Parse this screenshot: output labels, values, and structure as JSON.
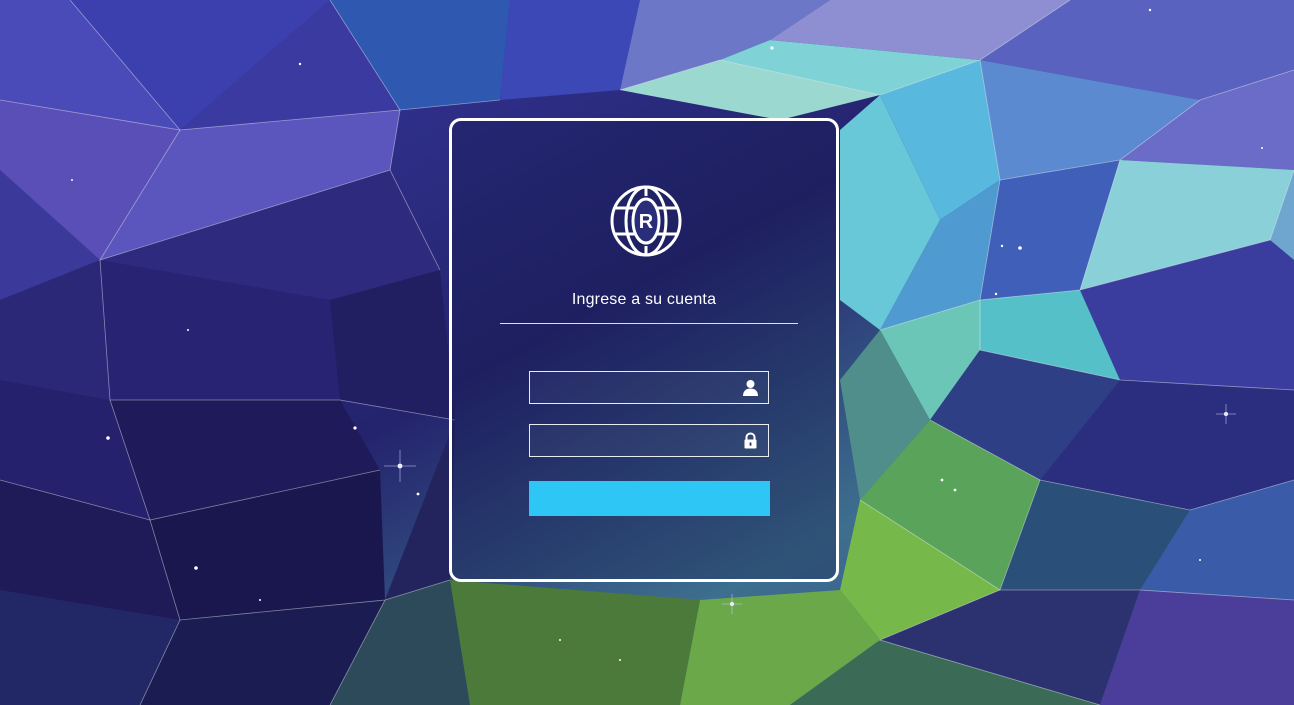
{
  "login": {
    "title": "Ingrese a su cuenta",
    "username": {
      "value": "",
      "placeholder": "",
      "icon": "user-icon"
    },
    "password": {
      "value": "",
      "placeholder": "",
      "icon": "lock-icon"
    },
    "submit_label": "",
    "logo": {
      "letter": "R",
      "icon": "globe-r-logo"
    }
  },
  "colors": {
    "accent": "#2ec7f5",
    "card_border": "#ffffff",
    "text": "#ffffff"
  }
}
